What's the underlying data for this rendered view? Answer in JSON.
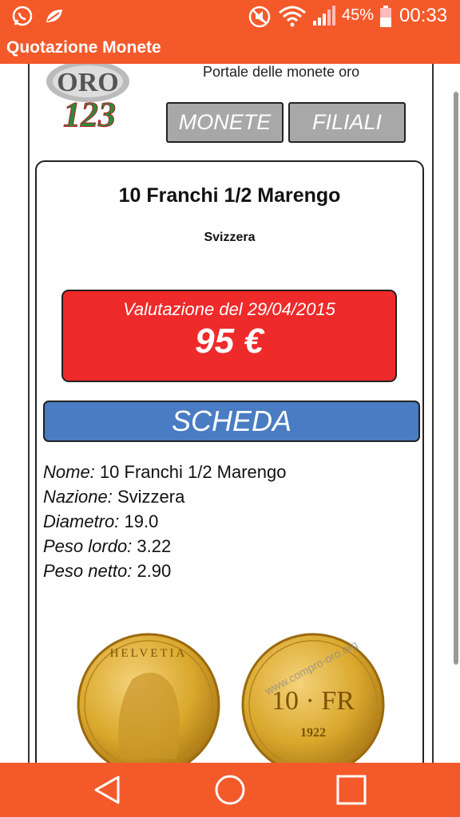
{
  "status_bar": {
    "battery_percent": "45%",
    "clock": "00:33",
    "icons": [
      "whatsapp-icon",
      "leaf-icon",
      "mute-icon",
      "wifi-icon",
      "signal-icon",
      "battery-icon"
    ]
  },
  "app_bar": {
    "title": "Quotazione Monete"
  },
  "header": {
    "logo_text": "ORO",
    "logo_number": "123",
    "subtitle": "Portale delle monete oro"
  },
  "nav": {
    "monete_label": "MONETE",
    "filiali_label": "FILIALI"
  },
  "coin": {
    "name": "10 Franchi 1/2 Marengo",
    "country": "Svizzera",
    "valuation_label": "Valutazione del 29/04/2015",
    "price": "95 €"
  },
  "scheda_label": "SCHEDA",
  "details": [
    {
      "label": "Nome:",
      "value": "10 Franchi 1/2 Marengo"
    },
    {
      "label": "Nazione:",
      "value": "Svizzera"
    },
    {
      "label": "Diametro:",
      "value": "19.0"
    },
    {
      "label": "Peso lordo:",
      "value": "3.22"
    },
    {
      "label": "Peso netto:",
      "value": "2.90"
    }
  ],
  "coin_image": {
    "obverse_text": "HELVETIA",
    "reverse_denomination": "10 · FR",
    "reverse_year": "1922",
    "watermark": "www.compro-oro.org"
  },
  "colors": {
    "accent": "#f4592a",
    "price_box": "#ee2a2a",
    "scheda": "#4a7cc3",
    "nav_button": "#a8a8a8",
    "gold": "#d9a82c"
  }
}
